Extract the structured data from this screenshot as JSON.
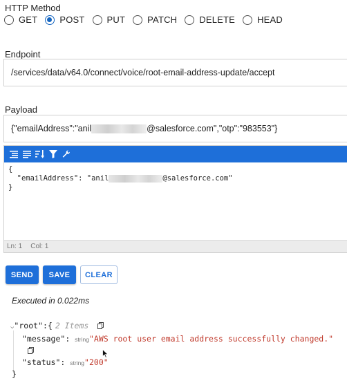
{
  "http_method": {
    "label": "HTTP Method",
    "options": [
      "GET",
      "POST",
      "PUT",
      "PATCH",
      "DELETE",
      "HEAD"
    ],
    "selected": "POST"
  },
  "endpoint": {
    "label": "Endpoint",
    "value": "/services/data/v64.0/connect/voice/root-email-address-update/accept"
  },
  "payload": {
    "label": "Payload",
    "value_prefix": "{\"emailAddress\":\"anil",
    "value_suffix": "@salesforce.com\",\"otp\":\"983553\"}"
  },
  "editor": {
    "toolbar_icons": [
      "format-icon",
      "compact-icon",
      "sort-icon",
      "filter-icon",
      "repair-icon"
    ],
    "line1": "{",
    "line2_prefix": "  \"emailAddress\": \"anil",
    "line2_suffix": "@salesforce.com\"",
    "line3": "}",
    "status_ln": "Ln: 1",
    "status_col": "Col: 1"
  },
  "buttons": {
    "send": "SEND",
    "save": "SAVE",
    "clear": "CLEAR"
  },
  "execution": {
    "text": "Executed in 0.022ms"
  },
  "response": {
    "root_key": "\"root\"",
    "root_open": ":{",
    "root_meta": "2 Items",
    "message_key": "\"message\"",
    "message_type": "string",
    "message_value": "\"AWS root user email address successfully changed.\"",
    "status_key": "\"status\"",
    "status_type": "string",
    "status_value": "\"200\"",
    "close": "}"
  },
  "colors": {
    "accent": "#1e6fd9",
    "radio_selected": "#1565c0",
    "string_value": "#c0392b"
  }
}
